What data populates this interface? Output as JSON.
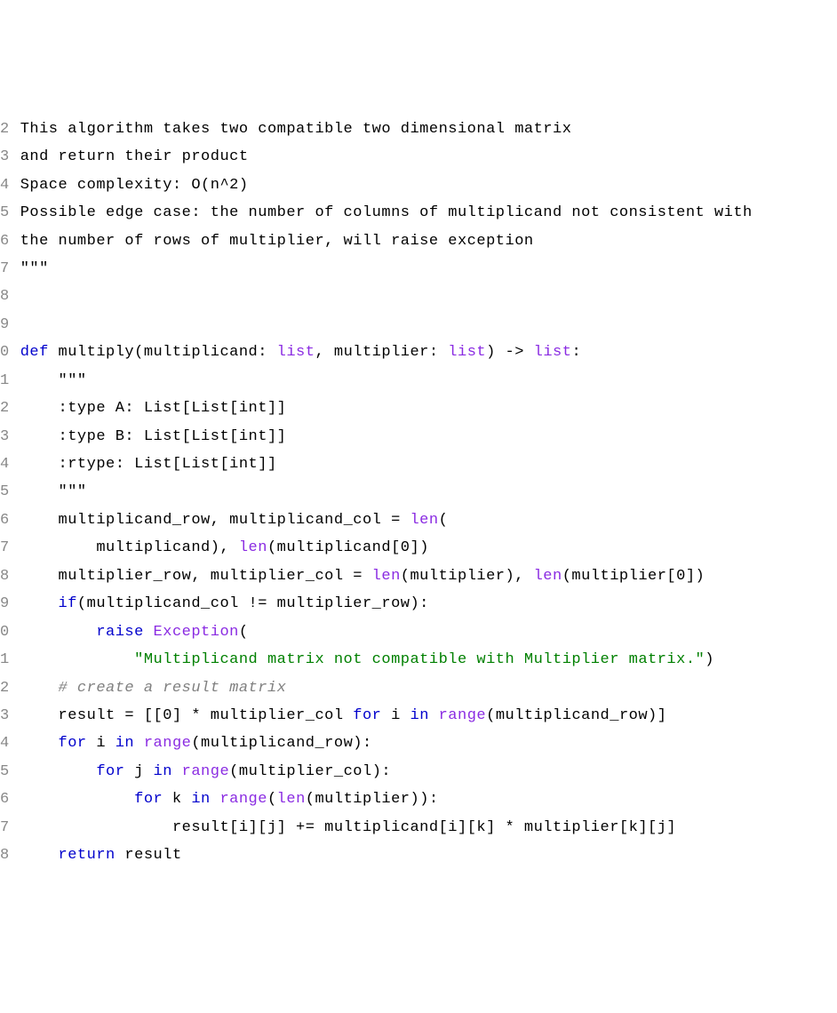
{
  "editor": {
    "gutter": [
      "2",
      "3",
      "4",
      "5",
      "6",
      "7",
      "8",
      "9",
      "0",
      "1",
      "2",
      "3",
      "4",
      "5",
      "6",
      "7",
      "8",
      "9",
      "0",
      "1",
      "2",
      "3",
      "4",
      "5",
      "6",
      "7",
      "8"
    ],
    "lines": [
      {
        "indent": 0,
        "tokens": [
          {
            "t": "plain",
            "v": "This algorithm takes two compatible two dimensional matrix"
          }
        ]
      },
      {
        "indent": 0,
        "tokens": [
          {
            "t": "plain",
            "v": "and return their product"
          }
        ]
      },
      {
        "indent": 0,
        "tokens": [
          {
            "t": "plain",
            "v": "Space complexity: O(n^2)"
          }
        ]
      },
      {
        "indent": 0,
        "tokens": [
          {
            "t": "plain",
            "v": "Possible edge case: the number of columns of multiplicand not consistent with"
          }
        ]
      },
      {
        "indent": 0,
        "tokens": [
          {
            "t": "plain",
            "v": "the number of rows of multiplier, will raise exception"
          }
        ]
      },
      {
        "indent": 0,
        "tokens": [
          {
            "t": "plain",
            "v": "\"\"\""
          }
        ]
      },
      {
        "indent": 0,
        "tokens": [
          {
            "t": "plain",
            "v": ""
          }
        ]
      },
      {
        "indent": 0,
        "tokens": [
          {
            "t": "plain",
            "v": ""
          }
        ]
      },
      {
        "indent": 0,
        "tokens": [
          {
            "t": "keyword",
            "v": "def"
          },
          {
            "t": "plain",
            "v": " multiply(multiplicand: "
          },
          {
            "t": "builtin",
            "v": "list"
          },
          {
            "t": "plain",
            "v": ", multiplier: "
          },
          {
            "t": "builtin",
            "v": "list"
          },
          {
            "t": "plain",
            "v": ") -> "
          },
          {
            "t": "builtin",
            "v": "list"
          },
          {
            "t": "plain",
            "v": ":"
          }
        ]
      },
      {
        "indent": 1,
        "tokens": [
          {
            "t": "plain",
            "v": "\"\"\""
          }
        ]
      },
      {
        "indent": 1,
        "tokens": [
          {
            "t": "plain",
            "v": ":type A: List[List[int]]"
          }
        ]
      },
      {
        "indent": 1,
        "tokens": [
          {
            "t": "plain",
            "v": ":type B: List[List[int]]"
          }
        ]
      },
      {
        "indent": 1,
        "tokens": [
          {
            "t": "plain",
            "v": ":rtype: List[List[int]]"
          }
        ]
      },
      {
        "indent": 1,
        "tokens": [
          {
            "t": "plain",
            "v": "\"\"\""
          }
        ]
      },
      {
        "indent": 1,
        "tokens": [
          {
            "t": "plain",
            "v": "multiplicand_row, multiplicand_col = "
          },
          {
            "t": "builtin",
            "v": "len"
          },
          {
            "t": "plain",
            "v": "("
          }
        ]
      },
      {
        "indent": 2,
        "tokens": [
          {
            "t": "plain",
            "v": "multiplicand), "
          },
          {
            "t": "builtin",
            "v": "len"
          },
          {
            "t": "plain",
            "v": "(multiplicand["
          },
          {
            "t": "number",
            "v": "0"
          },
          {
            "t": "plain",
            "v": "])"
          }
        ]
      },
      {
        "indent": 1,
        "tokens": [
          {
            "t": "plain",
            "v": "multiplier_row, multiplier_col = "
          },
          {
            "t": "builtin",
            "v": "len"
          },
          {
            "t": "plain",
            "v": "(multiplier), "
          },
          {
            "t": "builtin",
            "v": "len"
          },
          {
            "t": "plain",
            "v": "(multiplier["
          },
          {
            "t": "number",
            "v": "0"
          },
          {
            "t": "plain",
            "v": "])"
          }
        ]
      },
      {
        "indent": 1,
        "tokens": [
          {
            "t": "keyword",
            "v": "if"
          },
          {
            "t": "plain",
            "v": "(multiplicand_col != multiplier_row):"
          }
        ]
      },
      {
        "indent": 2,
        "tokens": [
          {
            "t": "keyword",
            "v": "raise"
          },
          {
            "t": "plain",
            "v": " "
          },
          {
            "t": "builtin",
            "v": "Exception"
          },
          {
            "t": "plain",
            "v": "("
          }
        ]
      },
      {
        "indent": 3,
        "tokens": [
          {
            "t": "string",
            "v": "\"Multiplicand matrix not compatible with Multiplier matrix.\""
          },
          {
            "t": "plain",
            "v": ")"
          }
        ]
      },
      {
        "indent": 1,
        "tokens": [
          {
            "t": "comment",
            "v": "# create a result matrix"
          }
        ]
      },
      {
        "indent": 1,
        "tokens": [
          {
            "t": "plain",
            "v": "result = [["
          },
          {
            "t": "number",
            "v": "0"
          },
          {
            "t": "plain",
            "v": "] * multiplier_col "
          },
          {
            "t": "keyword",
            "v": "for"
          },
          {
            "t": "plain",
            "v": " i "
          },
          {
            "t": "keyword",
            "v": "in"
          },
          {
            "t": "plain",
            "v": " "
          },
          {
            "t": "builtin",
            "v": "range"
          },
          {
            "t": "plain",
            "v": "(multiplicand_row)]"
          }
        ]
      },
      {
        "indent": 1,
        "tokens": [
          {
            "t": "keyword",
            "v": "for"
          },
          {
            "t": "plain",
            "v": " i "
          },
          {
            "t": "keyword",
            "v": "in"
          },
          {
            "t": "plain",
            "v": " "
          },
          {
            "t": "builtin",
            "v": "range"
          },
          {
            "t": "plain",
            "v": "(multiplicand_row):"
          }
        ]
      },
      {
        "indent": 2,
        "tokens": [
          {
            "t": "keyword",
            "v": "for"
          },
          {
            "t": "plain",
            "v": " j "
          },
          {
            "t": "keyword",
            "v": "in"
          },
          {
            "t": "plain",
            "v": " "
          },
          {
            "t": "builtin",
            "v": "range"
          },
          {
            "t": "plain",
            "v": "(multiplier_col):"
          }
        ]
      },
      {
        "indent": 3,
        "tokens": [
          {
            "t": "keyword",
            "v": "for"
          },
          {
            "t": "plain",
            "v": " k "
          },
          {
            "t": "keyword",
            "v": "in"
          },
          {
            "t": "plain",
            "v": " "
          },
          {
            "t": "builtin",
            "v": "range"
          },
          {
            "t": "plain",
            "v": "("
          },
          {
            "t": "builtin",
            "v": "len"
          },
          {
            "t": "plain",
            "v": "(multiplier)):"
          }
        ]
      },
      {
        "indent": 4,
        "tokens": [
          {
            "t": "plain",
            "v": "result[i][j] += multiplicand[i][k] * multiplier[k][j]"
          }
        ]
      },
      {
        "indent": 1,
        "tokens": [
          {
            "t": "keyword",
            "v": "return"
          },
          {
            "t": "plain",
            "v": " result"
          }
        ]
      }
    ],
    "indent_unit": "    "
  }
}
